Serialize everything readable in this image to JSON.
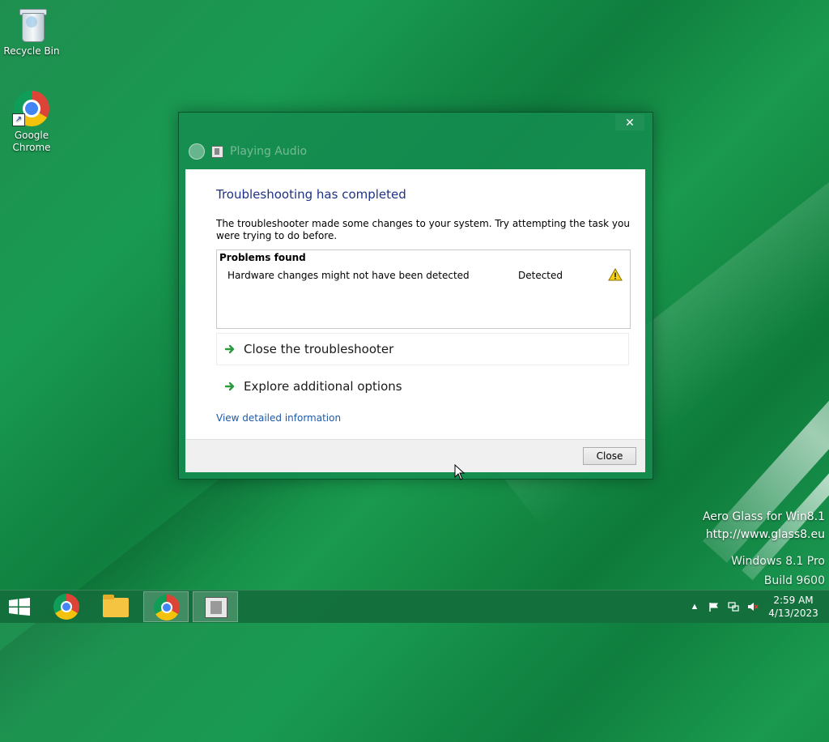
{
  "desktop": {
    "icons": [
      {
        "label": "Recycle Bin",
        "icon": "recycle-bin-icon"
      },
      {
        "label": "Google\nChrome",
        "icon": "chrome-icon"
      }
    ]
  },
  "dialog": {
    "title": "Playing Audio",
    "close_glyph": "✕",
    "heading": "Troubleshooting has completed",
    "description": "The troubleshooter made some changes to your system. Try attempting the task you were trying to do before.",
    "problems": {
      "header": "Problems found",
      "rows": [
        {
          "name": "Hardware changes might not have been detected",
          "status": "Detected",
          "icon": "warning-icon"
        }
      ]
    },
    "options": [
      {
        "label": "Close the troubleshooter",
        "icon": "green-arrow-icon"
      },
      {
        "label": "Explore additional options",
        "icon": "green-arrow-icon"
      }
    ],
    "link": "View detailed information",
    "close_button": "Close"
  },
  "watermark": {
    "line1": "Aero Glass for Win8.1",
    "line2": "http://www.glass8.eu",
    "line3": "Windows 8.1 Pro",
    "line4": "Build 9600"
  },
  "taskbar": {
    "items": [
      "chrome",
      "file-explorer",
      "chrome",
      "troubleshooter-window"
    ],
    "clock": {
      "time": "2:59 AM",
      "date": "4/13/2023"
    }
  },
  "colors": {
    "accent": "#1e3287",
    "link": "#1e5aa8",
    "desktop": "#199a52"
  }
}
